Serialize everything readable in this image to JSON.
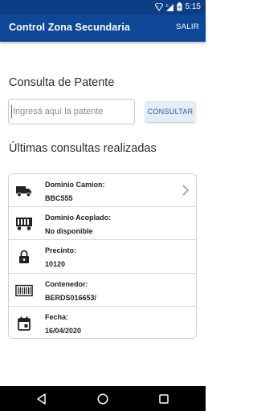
{
  "status_bar": {
    "time": "5:15",
    "icons": [
      "wifi-icon",
      "signal-icon",
      "battery-charging-icon"
    ]
  },
  "app_bar": {
    "title": "Control Zona Secundaria",
    "exit_label": "SALIR"
  },
  "search": {
    "section_title": "Consulta de Patente",
    "placeholder": "Ingresá aquí la patente",
    "value": "",
    "button_label": "CONSULTAR"
  },
  "recent": {
    "section_title": "Últimas consultas realizadas",
    "rows": [
      {
        "icon": "truck-icon",
        "label": "Dominio Camion:",
        "value": "BBC555",
        "has_chevron": true
      },
      {
        "icon": "trailer-icon",
        "label": "Dominio Acoplado:",
        "value": "No disponible",
        "has_chevron": false
      },
      {
        "icon": "lock-icon",
        "label": "Precinto:",
        "value": "10120",
        "has_chevron": false
      },
      {
        "icon": "container-icon",
        "label": "Contenedor:",
        "value": "BERDS016653/",
        "has_chevron": false
      },
      {
        "icon": "calendar-icon",
        "label": "Fecha:",
        "value": "16/04/2020",
        "has_chevron": false
      }
    ]
  },
  "nav_bar": {
    "buttons": [
      "back-icon",
      "home-icon",
      "recents-icon"
    ]
  },
  "colors": {
    "app_bar": "#0d4796",
    "status_bar": "#0c3e86",
    "accent": "#1e5fb0",
    "button_bg": "#e4ecf6"
  }
}
